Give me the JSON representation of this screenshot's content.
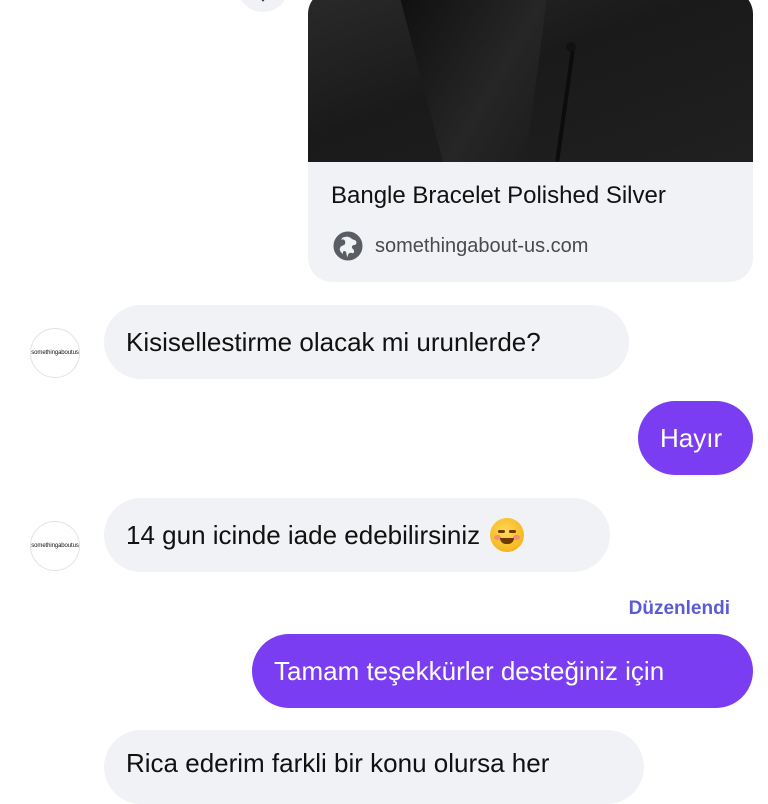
{
  "link_preview": {
    "title": "Bangle Bracelet Polished Silver",
    "domain": "somethingabout-us.com",
    "image": "dark shirt product photo",
    "domain_icon": "globe-icon"
  },
  "reply_button": {
    "icon": "reply-icon"
  },
  "avatar_label": "somethingaboutus",
  "messages": [
    {
      "side": "incoming",
      "text": "Kisisellestirme olacak mi urunlerde?"
    },
    {
      "side": "outgoing",
      "text": "Hayır"
    },
    {
      "side": "incoming",
      "text": "14 gun icinde iade edebilirsiniz",
      "emoji": "smiling-blush-emoji"
    },
    {
      "side": "outgoing",
      "text": "Tamam teşekkürler desteğiniz için",
      "status": "Düzenlendi"
    },
    {
      "side": "incoming",
      "text": "Rica ederim farkli bir konu olursa her"
    }
  ],
  "colors": {
    "outgoing_bubble": "#7b3df2",
    "incoming_bubble": "#f0f2f5",
    "edited_label": "#5b5bd6"
  }
}
